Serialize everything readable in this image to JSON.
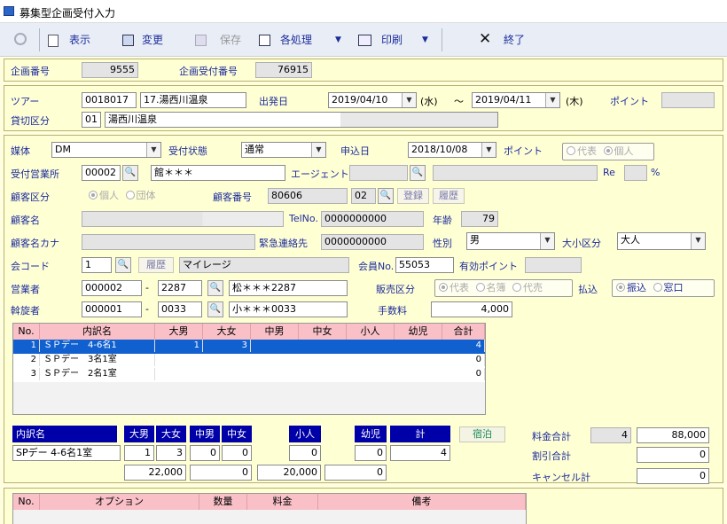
{
  "window": {
    "title": "募集型企画受付入力"
  },
  "toolbar": {
    "display": "表示",
    "change": "変更",
    "save": "保存",
    "batch": "各処理",
    "print": "印刷",
    "exit": "終了"
  },
  "header": {
    "kikaku_label": "企画番号",
    "kikaku_value": "9555",
    "uketsuke_label": "企画受付番号",
    "uketsuke_value": "76915"
  },
  "tour": {
    "label": "ツアー",
    "code": "0018017",
    "name": "17.湯西川温泉",
    "depart_label": "出発日",
    "depart_date": "2019/04/10",
    "depart_dow": "(水)",
    "tilde": "～",
    "return_date": "2019/04/11",
    "return_dow": "(木)",
    "point_label": "ポイント",
    "charter_label": "貸切区分",
    "charter_code": "01",
    "charter_name": "湯西川温泉"
  },
  "form": {
    "media_label": "媒体",
    "media_value": "DM",
    "status_label": "受付状態",
    "status_value": "通常",
    "apply_label": "申込日",
    "apply_date": "2018/10/08",
    "point_label": "ポイント",
    "rep_opt": "代表",
    "ind_opt": "個人",
    "office_label": "受付営業所",
    "office_code": "00002",
    "office_name": "館＊＊＊",
    "agent_label": "エージェント",
    "re_label": "Re",
    "pct": "%",
    "cust_type_label": "顧客区分",
    "cust_ind": "個人",
    "cust_group": "団体",
    "cust_no_label": "顧客番号",
    "cust_no": "80606",
    "cust_sub": "02",
    "register_btn": "登録",
    "history_btn": "履歴",
    "name_label": "顧客名",
    "tel_label": "TelNo.",
    "tel": "0000000000",
    "age_label": "年齢",
    "age": "79",
    "kana_label": "顧客名カナ",
    "emergency_label": "緊急連絡先",
    "emergency": "0000000000",
    "gender_label": "性別",
    "gender": "男",
    "size_label": "大小区分",
    "size": "大人",
    "member_code_label": "会コード",
    "member_code": "1",
    "member_history": "履歴",
    "member_type": "マイレージ",
    "member_no_label": "会員No.",
    "member_no": "55053",
    "valid_point_label": "有効ポイント",
    "sales_label": "営業者",
    "sales_code": "000002",
    "sales_dash": "-",
    "sales_sub": "2287",
    "sales_name": "松＊＊＊2287",
    "sales_div_label": "販売区分",
    "div_rep": "代表",
    "div_list": "名簿",
    "div_proxy": "代売",
    "pay_label": "払込",
    "pay_transfer": "振込",
    "pay_window": "窓口",
    "broker_label": "斡旋者",
    "broker_code": "000001",
    "broker_dash": "-",
    "broker_sub": "0033",
    "broker_name": "小＊＊＊0033",
    "fee_label": "手数料",
    "fee": "4,000"
  },
  "grid1": {
    "headers": [
      "No.",
      "内訳名",
      "大男",
      "大女",
      "中男",
      "中女",
      "小人",
      "幼児",
      "合計"
    ],
    "rows": [
      [
        "1",
        "ＳＰデー　4-6名1",
        "1",
        "3",
        "",
        "",
        "",
        "",
        "4"
      ],
      [
        "2",
        "ＳＰデー　3名1室",
        "",
        "",
        "",
        "",
        "",
        "",
        "0"
      ],
      [
        "3",
        "ＳＰデー　2名1室",
        "",
        "",
        "",
        "",
        "",
        "",
        "0"
      ]
    ]
  },
  "breakdown": {
    "headers": [
      "内訳名",
      "大男",
      "大女",
      "中男",
      "中女",
      "小人",
      "幼児",
      "計"
    ],
    "stay_btn": "宿泊",
    "name": "SPデー 4-6名1室",
    "v1": "1",
    "v2": "3",
    "v3": "0",
    "v4": "0",
    "v5": "0",
    "v6": "0",
    "v7": "4",
    "a1": "22,000",
    "a2": "0",
    "a3": "20,000",
    "a4": "0"
  },
  "totals": {
    "fee_total_label": "料金合計",
    "fee_total_count": "4",
    "fee_total": "88,000",
    "discount_label": "割引合計",
    "discount": "0",
    "cancel_label": "キャンセル計",
    "cancel": "0"
  },
  "grid2": {
    "headers": [
      "No.",
      "オプション",
      "数量",
      "料金",
      "備考"
    ]
  }
}
